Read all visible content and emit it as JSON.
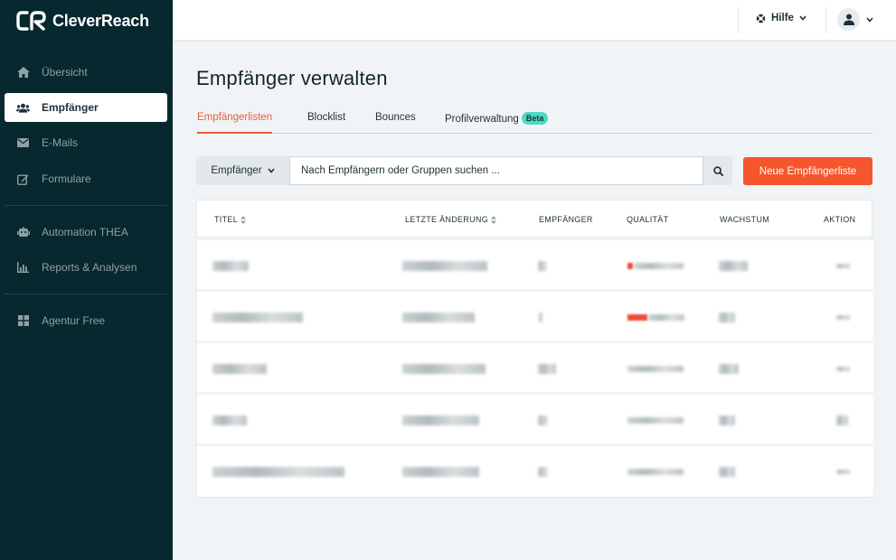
{
  "brand": {
    "name": "CleverReach"
  },
  "sidebar": {
    "items": [
      {
        "label": "Übersicht",
        "icon": "home-icon"
      },
      {
        "label": "Empfänger",
        "icon": "users-icon",
        "active": true
      },
      {
        "label": "E-Mails",
        "icon": "envelope-icon"
      },
      {
        "label": "Formulare",
        "icon": "edit-icon"
      },
      {
        "label": "Automation THEA",
        "icon": "robot-icon"
      },
      {
        "label": "Reports & Analysen",
        "icon": "bar-chart-icon"
      },
      {
        "label": "Agentur Free",
        "icon": "grid-icon"
      }
    ]
  },
  "topbar": {
    "help_label": "Hilfe"
  },
  "page": {
    "title": "Empfänger verwalten"
  },
  "tabs": [
    {
      "label": "Empfängerlisten",
      "active": true
    },
    {
      "label": "Blocklist"
    },
    {
      "label": "Bounces"
    },
    {
      "label": "Profilverwaltung",
      "badge": "Beta"
    }
  ],
  "filter": {
    "select_label": "Empfänger",
    "search_placeholder": "Nach Empfängern oder Gruppen suchen ...",
    "new_button": "Neue Empfängerliste"
  },
  "table": {
    "columns": [
      "TITEL",
      "LETZTE ÄNDERUNG",
      "EMPFÄNGER",
      "QUALITÄT",
      "WACHSTUM",
      "AKTION"
    ],
    "rows_visible": 5
  },
  "colors": {
    "sidebar": "#06282e",
    "accent": "#f5562d",
    "badge": "#4fd8c4"
  }
}
